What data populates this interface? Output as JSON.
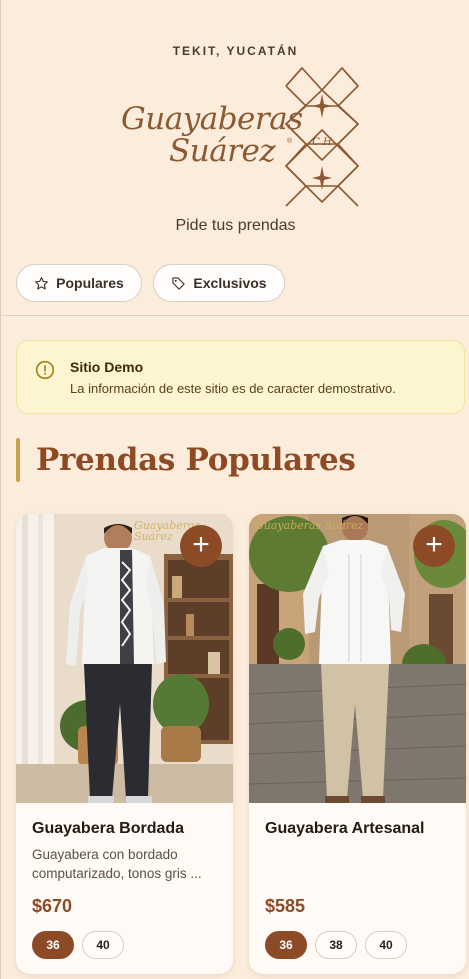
{
  "header": {
    "location": "TEKIT, YUCATÁN",
    "brand_line1": "Guayaberas",
    "brand_line2": "Suárez",
    "registered": "®",
    "monogram": "C H",
    "tagline": "Pide tus prendas"
  },
  "filters": [
    {
      "label": "Populares",
      "icon": "star-icon"
    },
    {
      "label": "Exclusivos",
      "icon": "tag-icon"
    }
  ],
  "notice": {
    "title": "Sitio Demo",
    "text": "La información de este sitio es de caracter demostrativo.",
    "icon": "alert-circle-icon"
  },
  "section": {
    "title": "Prendas Populares"
  },
  "products": [
    {
      "name": "Guayabera Bordada",
      "description": "Guayabera con bordado computarizado, tonos gris ...",
      "price": "$670",
      "add_label": "+",
      "watermark": "Guayaberas Suárez",
      "sizes": [
        "36",
        "40"
      ],
      "selected_size": "36"
    },
    {
      "name": "Guayabera Artesanal",
      "description": "",
      "price": "$585",
      "add_label": "+",
      "watermark": "Guayaberas Suárez",
      "sizes": [
        "36",
        "38",
        "40"
      ],
      "selected_size": "36"
    }
  ],
  "colors": {
    "background": "#fcecdc",
    "accent": "#8c4a27",
    "section_bar": "#caa24f",
    "notice_bg": "#fdf5cf"
  }
}
